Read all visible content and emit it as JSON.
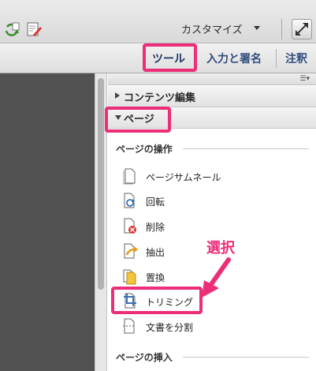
{
  "toolbar": {
    "customize_label": "カスタマイズ",
    "icons": [
      "refresh-icon",
      "edit-document-icon",
      "expand-icon",
      "chevron-down-icon"
    ]
  },
  "tabs": [
    {
      "label": "ツール",
      "active": true
    },
    {
      "label": "入力と署名",
      "active": false
    },
    {
      "label": "注釈",
      "active": false
    }
  ],
  "panel": {
    "sections": [
      {
        "label": "コンテンツ編集",
        "expanded": false
      },
      {
        "label": "ページ",
        "expanded": true
      }
    ],
    "groups": [
      {
        "title": "ページの操作",
        "items": [
          {
            "label": "ページサムネール",
            "icon": "page-thumbnail-icon"
          },
          {
            "label": "回転",
            "icon": "rotate-icon"
          },
          {
            "label": "削除",
            "icon": "delete-page-icon"
          },
          {
            "label": "抽出",
            "icon": "extract-icon"
          },
          {
            "label": "置換",
            "icon": "replace-icon"
          },
          {
            "label": "トリミング",
            "icon": "crop-icon"
          },
          {
            "label": "文書を分割",
            "icon": "split-document-icon"
          }
        ]
      },
      {
        "title": "ページの挿入",
        "items": []
      }
    ]
  },
  "annotation": {
    "label": "選択",
    "color": "#ec2e79"
  },
  "colors": {
    "highlight": "#ec2e79",
    "tab_text": "#334d7d",
    "document_bg": "#525252"
  }
}
